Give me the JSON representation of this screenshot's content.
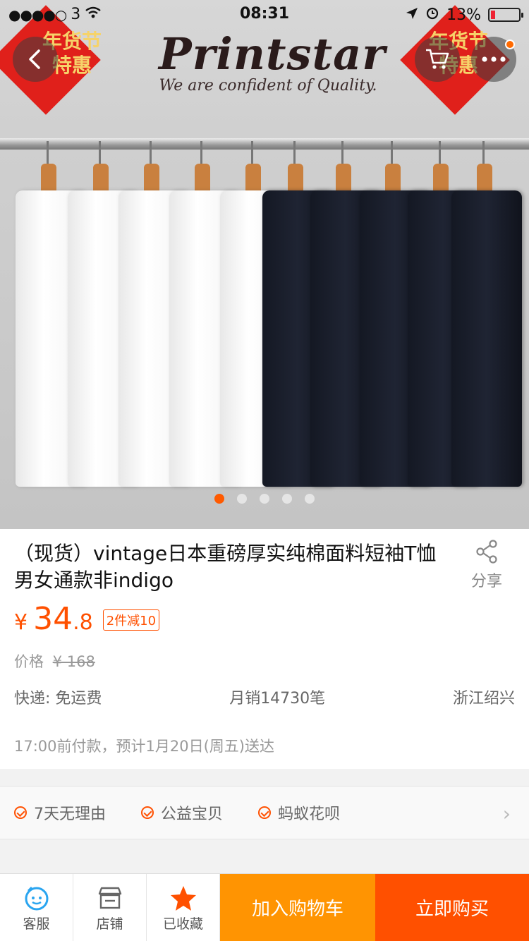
{
  "status_bar": {
    "carrier": "3",
    "time": "08:31",
    "battery": "13%",
    "battery_level": 0.13
  },
  "hero": {
    "brand_name": "Printstar",
    "brand_tagline": "We are confident of Quality.",
    "badge_text": "年货节\n特惠",
    "carousel_count": 5,
    "carousel_active": 1
  },
  "product": {
    "title": "（现货）vintage日本重磅厚实纯棉面料短袖T恤男女通款非indigo",
    "share_label": "分享",
    "currency": "¥",
    "price_int": "34",
    "price_dec": ".8",
    "promo_tag": "2件减10",
    "original_label": "价格",
    "original_price": "¥ 168",
    "shipping": "快递: 免运费",
    "monthly_sales": "月销14730笔",
    "location": "浙江绍兴",
    "delivery_estimate": "17:00前付款，预计1月20日(周五)送达"
  },
  "guarantees": [
    "7天无理由",
    "公益宝贝",
    "蚂蚁花呗"
  ],
  "bottom_bar": {
    "service_label": "客服",
    "shop_label": "店铺",
    "favorite_label": "已收藏",
    "add_to_cart": "加入购物车",
    "buy_now": "立即购买"
  },
  "colors": {
    "accent": "#ff5000",
    "cart_button": "#ff9402",
    "buy_button": "#ff5000",
    "badge_red": "#e0201b"
  }
}
